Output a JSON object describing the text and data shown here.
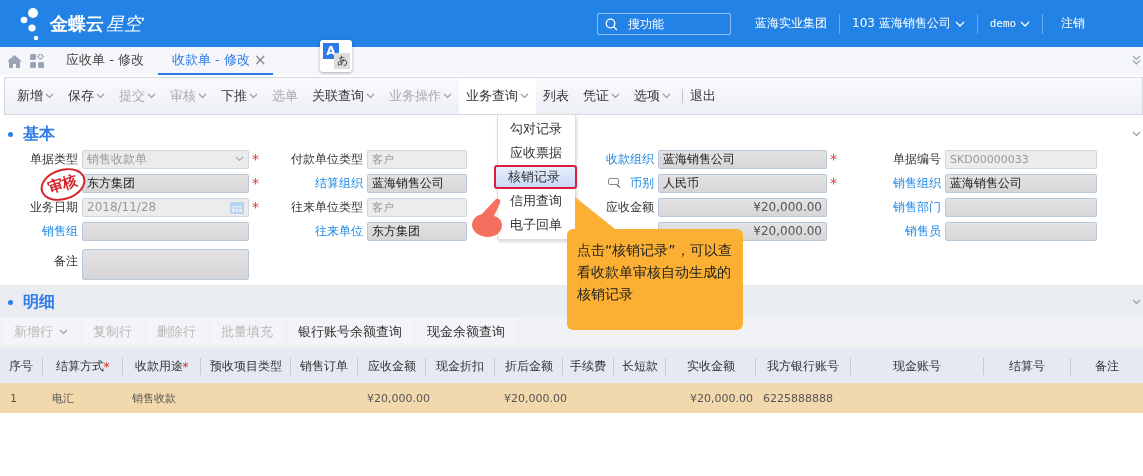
{
  "header": {
    "logo_main": "金蝶云",
    "logo_sub": "星空",
    "search": {
      "placeholder": "搜功能"
    },
    "items": [
      {
        "label": "蓝海实业集团",
        "dropdown": false
      },
      {
        "label": "103 蓝海销售公司",
        "dropdown": true
      },
      {
        "label": "demo",
        "dropdown": true
      },
      {
        "label": "注销",
        "dropdown": false
      }
    ]
  },
  "tabs": [
    {
      "label": "应收单 - 修改",
      "selected": false
    },
    {
      "label": "收款单 - 修改",
      "selected": true,
      "close": "×"
    }
  ],
  "translate_badge": {
    "top": "A",
    "bottom": "あ"
  },
  "required_mark": "*",
  "toolbar": [
    {
      "label": "新增",
      "dropdown": true,
      "disabled": false,
      "selected": false,
      "divider": false
    },
    {
      "label": "保存",
      "dropdown": true,
      "disabled": false,
      "selected": false,
      "divider": false
    },
    {
      "label": "提交",
      "dropdown": true,
      "disabled": true,
      "selected": false,
      "divider": false
    },
    {
      "label": "审核",
      "dropdown": true,
      "disabled": true,
      "selected": false,
      "divider": false
    },
    {
      "label": "下推",
      "dropdown": true,
      "disabled": false,
      "selected": false,
      "divider": false
    },
    {
      "label": "选单",
      "dropdown": false,
      "disabled": true,
      "selected": false,
      "divider": false
    },
    {
      "label": "关联查询",
      "dropdown": true,
      "disabled": false,
      "selected": false,
      "divider": false
    },
    {
      "label": "业务操作",
      "dropdown": true,
      "disabled": true,
      "selected": false,
      "divider": false
    },
    {
      "label": "业务查询",
      "dropdown": true,
      "disabled": false,
      "selected": true,
      "divider": false
    },
    {
      "label": "列表",
      "dropdown": false,
      "disabled": false,
      "selected": false,
      "divider": false
    },
    {
      "label": "凭证",
      "dropdown": true,
      "disabled": false,
      "selected": false,
      "divider": false
    },
    {
      "label": "选项",
      "dropdown": true,
      "disabled": false,
      "selected": false,
      "divider": true
    },
    {
      "label": "退出",
      "dropdown": false,
      "disabled": false,
      "selected": false,
      "divider": false
    }
  ],
  "menu": [
    {
      "label": "勾对记录",
      "selected": false
    },
    {
      "label": "应收票据",
      "selected": false
    },
    {
      "label": "核销记录",
      "selected": true
    },
    {
      "label": "信用查询",
      "selected": false
    },
    {
      "label": "电子回单",
      "selected": false
    }
  ],
  "basic": {
    "title": "基本",
    "stamp": "审核",
    "columns": [
      [
        {
          "label": "单据类型",
          "value": "销售收款单",
          "kind": "select",
          "linked": false,
          "disabled": true,
          "required": true
        },
        {
          "value": "东方集团",
          "kind": "text",
          "disabled": false,
          "required": true
        },
        {
          "label": "业务日期",
          "value": "2018/11/28",
          "kind": "date",
          "linked": false,
          "disabled": true,
          "required": true
        },
        {
          "label": "销售组",
          "kind": "text",
          "linked": true,
          "disabled": false,
          "required": false
        },
        {
          "label": "备注",
          "kind": "textarea",
          "linked": false,
          "disabled": false,
          "required": false
        }
      ],
      [
        {
          "label": "付款单位类型",
          "value": "客户",
          "kind": "text",
          "linked": false,
          "disabled": true,
          "required": false
        },
        {
          "label": "结算组织",
          "value": "蓝海销售公司",
          "kind": "text",
          "linked": true,
          "disabled": false,
          "required": false
        },
        {
          "label": "往来单位类型",
          "value": "客户",
          "kind": "text",
          "linked": false,
          "disabled": true,
          "required": false
        },
        {
          "label": "往来单位",
          "value": "东方集团",
          "kind": "text",
          "linked": true,
          "disabled": false,
          "required": false
        }
      ],
      [
        {
          "label": "收款组织",
          "value": "蓝海销售公司",
          "kind": "text",
          "linked": true,
          "disabled": false,
          "required": true
        },
        {
          "label": "币别",
          "value": "人民币",
          "kind": "text",
          "linked": true,
          "disabled": false,
          "required": true
        },
        {
          "label": "应收金额",
          "value": "¥20,000.00",
          "kind": "amount",
          "linked": false,
          "disabled": false,
          "required": false
        },
        {
          "value": "¥20,000.00",
          "kind": "amount",
          "disabled": false,
          "required": false
        }
      ],
      [
        {
          "label": "单据编号",
          "value": "SKD00000033",
          "kind": "text",
          "linked": false,
          "disabled": true,
          "required": false
        },
        {
          "label": "销售组织",
          "value": "蓝海销售公司",
          "kind": "text",
          "linked": true,
          "disabled": false,
          "required": false
        },
        {
          "label": "销售部门",
          "kind": "text",
          "linked": true,
          "disabled": false,
          "required": false
        },
        {
          "label": "销售员",
          "kind": "text",
          "linked": true,
          "disabled": false,
          "required": false
        }
      ]
    ]
  },
  "detail": {
    "title": "明细",
    "buttons": [
      {
        "label": "新增行",
        "dropdown": true,
        "disabled": true
      },
      {
        "label": "复制行",
        "dropdown": false,
        "disabled": true
      },
      {
        "label": "删除行",
        "dropdown": false,
        "disabled": true
      },
      {
        "label": "批量填充",
        "dropdown": false,
        "disabled": true
      },
      {
        "label": "银行账号余额查询",
        "dropdown": false,
        "disabled": false
      },
      {
        "label": "现金余额查询",
        "dropdown": false,
        "disabled": false
      }
    ],
    "columns": [
      {
        "label": "序号",
        "required": false
      },
      {
        "label": "结算方式",
        "required": true
      },
      {
        "label": "收款用途",
        "required": true
      },
      {
        "label": "预收项目类型",
        "required": false
      },
      {
        "label": "销售订单",
        "required": false
      },
      {
        "label": "应收金额",
        "required": false
      },
      {
        "label": "现金折扣",
        "required": false
      },
      {
        "label": "折后金额",
        "required": false
      },
      {
        "label": "手续费",
        "required": false
      },
      {
        "label": "长短款",
        "required": false
      },
      {
        "label": "实收金额",
        "required": false
      },
      {
        "label": "我方银行账号",
        "required": false
      },
      {
        "label": "现金账号",
        "required": false
      },
      {
        "label": "结算号",
        "required": false
      },
      {
        "label": "备注",
        "required": false
      }
    ],
    "rows": [
      {
        "selected": true,
        "cells": [
          "1",
          "电汇",
          "销售收款",
          null,
          null,
          "¥20,000.00",
          null,
          "¥20,000.00",
          null,
          null,
          "¥20,000.00",
          "6225888888",
          null,
          null,
          null
        ]
      }
    ]
  },
  "callout": "点击“核销记录”，可以查看收款单审核自动生成的核销记录"
}
